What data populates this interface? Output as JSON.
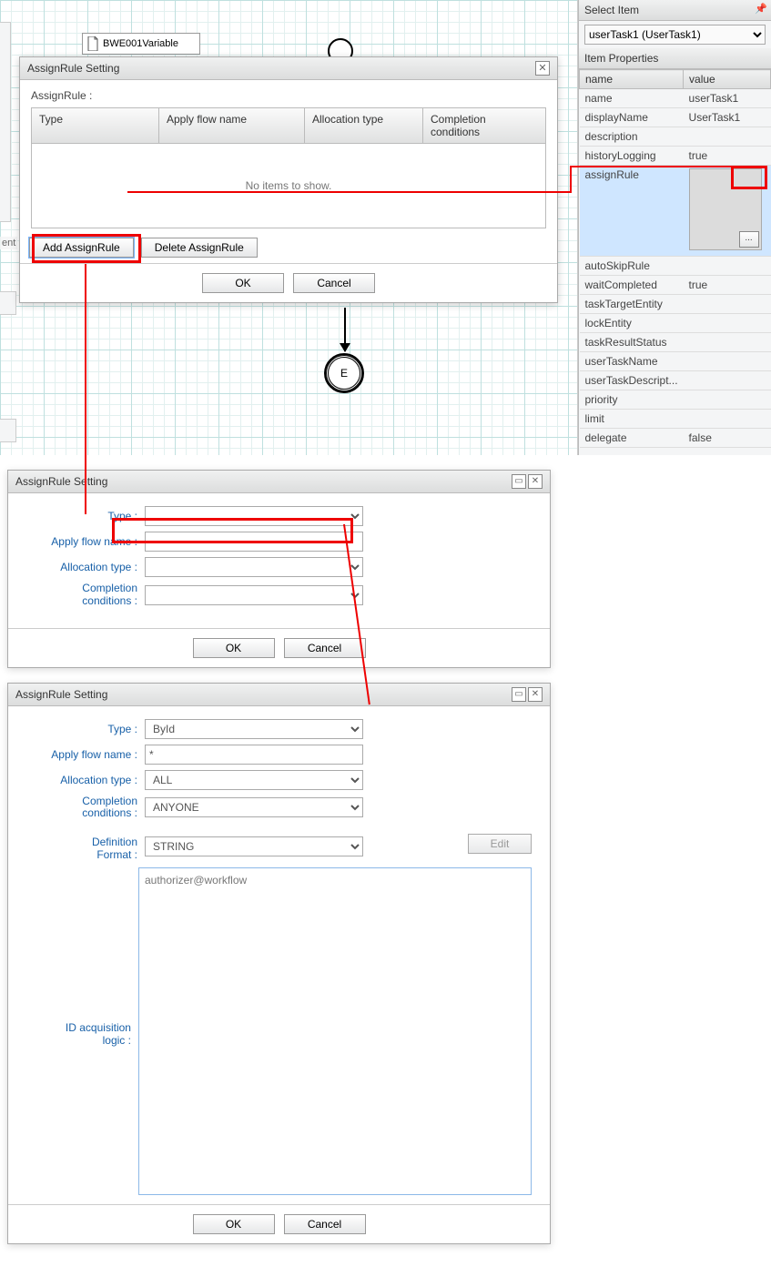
{
  "canvas": {
    "variable_box": "BWE001Variable",
    "end_label": "E",
    "ent_label": "ent"
  },
  "right": {
    "select_item_title": "Select Item",
    "dropdown_value": "userTask1 (UserTask1)",
    "props_title": "Item Properties",
    "header_name": "name",
    "header_value": "value",
    "rows": [
      {
        "k": "name",
        "v": "userTask1"
      },
      {
        "k": "displayName",
        "v": "UserTask1"
      },
      {
        "k": "description",
        "v": ""
      },
      {
        "k": "historyLogging",
        "v": "true"
      }
    ],
    "assign_key": "assignRule",
    "ellipsis": "...",
    "rows2": [
      {
        "k": "autoSkipRule",
        "v": ""
      },
      {
        "k": "waitCompleted",
        "v": "true"
      },
      {
        "k": "taskTargetEntity",
        "v": ""
      },
      {
        "k": "lockEntity",
        "v": ""
      },
      {
        "k": "taskResultStatus",
        "v": ""
      },
      {
        "k": "userTaskName",
        "v": ""
      },
      {
        "k": "userTaskDescript...",
        "v": ""
      },
      {
        "k": "priority",
        "v": ""
      },
      {
        "k": "limit",
        "v": ""
      },
      {
        "k": "delegate",
        "v": "false"
      }
    ]
  },
  "dlg1": {
    "title": "AssignRule Setting",
    "label": "AssignRule :",
    "cols": {
      "type": "Type",
      "flow": "Apply flow name",
      "alloc": "Allocation type",
      "comp": "Completion conditions"
    },
    "empty": "No items to show.",
    "add": "Add AssignRule",
    "del": "Delete AssignRule",
    "ok": "OK",
    "cancel": "Cancel"
  },
  "dlg2": {
    "title": "AssignRule Setting",
    "type_label": "Type :",
    "type_value": "",
    "flow_label": "Apply flow name :",
    "flow_value": "",
    "alloc_label": "Allocation type :",
    "alloc_value": "",
    "comp_label": "Completion\nconditions :",
    "comp_value": "",
    "ok": "OK",
    "cancel": "Cancel"
  },
  "dlg3": {
    "title": "AssignRule Setting",
    "type_label": "Type :",
    "type_value": "ById",
    "flow_label": "Apply flow name :",
    "flow_value": "*",
    "alloc_label": "Allocation type :",
    "alloc_value": "ALL",
    "comp_label": "Completion\nconditions :",
    "comp_value": "ANYONE",
    "def_label": "Definition\nFormat :",
    "def_value": "STRING",
    "edit": "Edit",
    "logic_label": "ID acquisition\nlogic :",
    "logic_value": "authorizer@workflow",
    "ok": "OK",
    "cancel": "Cancel"
  }
}
